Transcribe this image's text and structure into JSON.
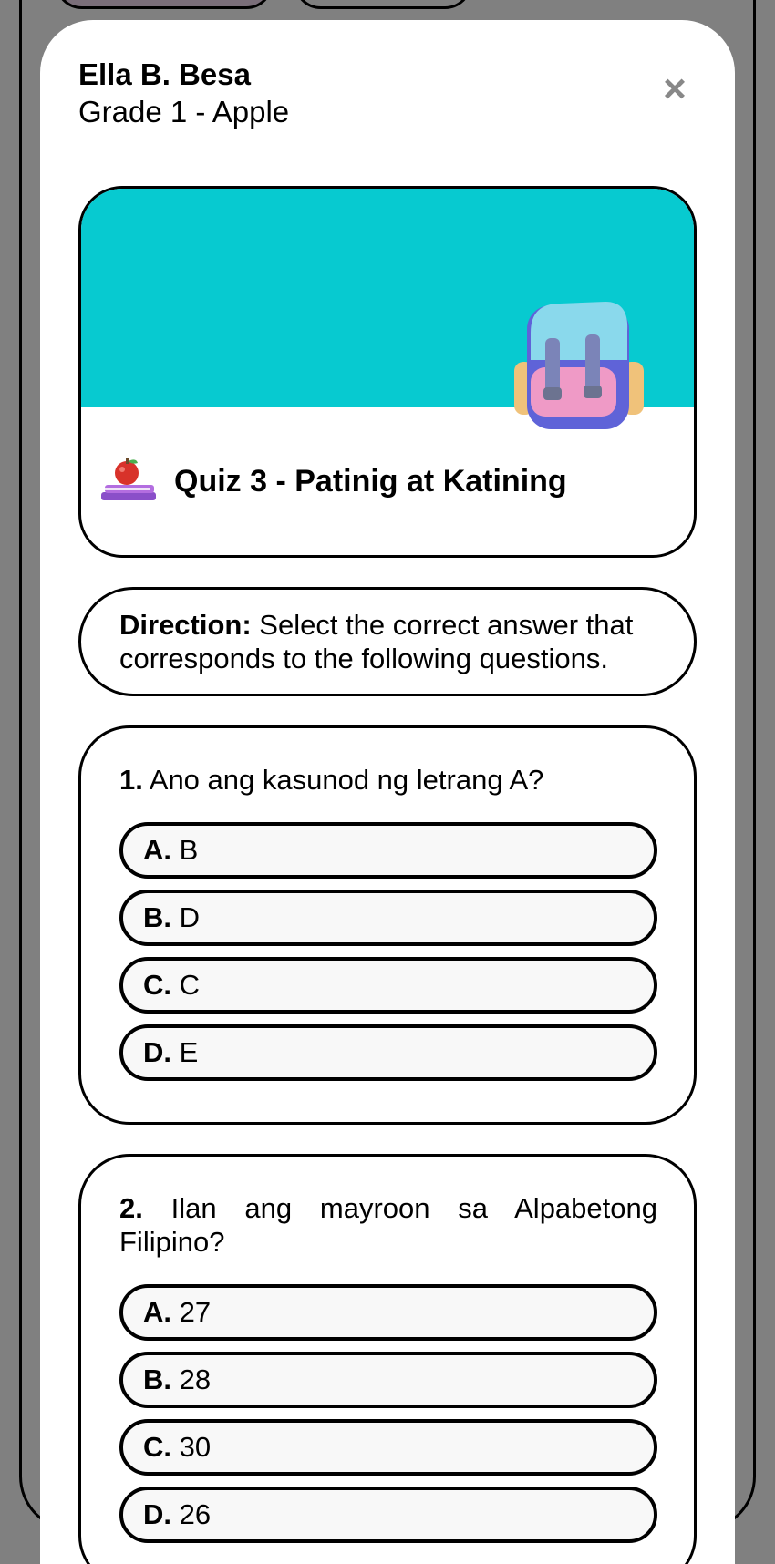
{
  "student": {
    "name": "Ella B. Besa",
    "grade": "Grade 1 - Apple"
  },
  "close_label": "×",
  "quiz": {
    "title": "Quiz 3 - Patinig at Katining",
    "banner_color": "#07cad0"
  },
  "direction": {
    "label": "Direction:",
    "text": " Select the correct answer that corresponds to the following questions."
  },
  "questions": [
    {
      "number": "1.",
      "text": " Ano ang kasunod ng letrang A?",
      "options": [
        {
          "letter": "A.",
          "text": " B"
        },
        {
          "letter": "B.",
          "text": " D"
        },
        {
          "letter": "C.",
          "text": " C"
        },
        {
          "letter": "D.",
          "text": " E"
        }
      ]
    },
    {
      "number": "2.",
      "text": " Ilan ang mayroon sa Alpabetong Filipino?",
      "options": [
        {
          "letter": "A.",
          "text": " 27"
        },
        {
          "letter": "B.",
          "text": " 28"
        },
        {
          "letter": "C.",
          "text": " 30"
        },
        {
          "letter": "D.",
          "text": " 26"
        }
      ]
    }
  ]
}
